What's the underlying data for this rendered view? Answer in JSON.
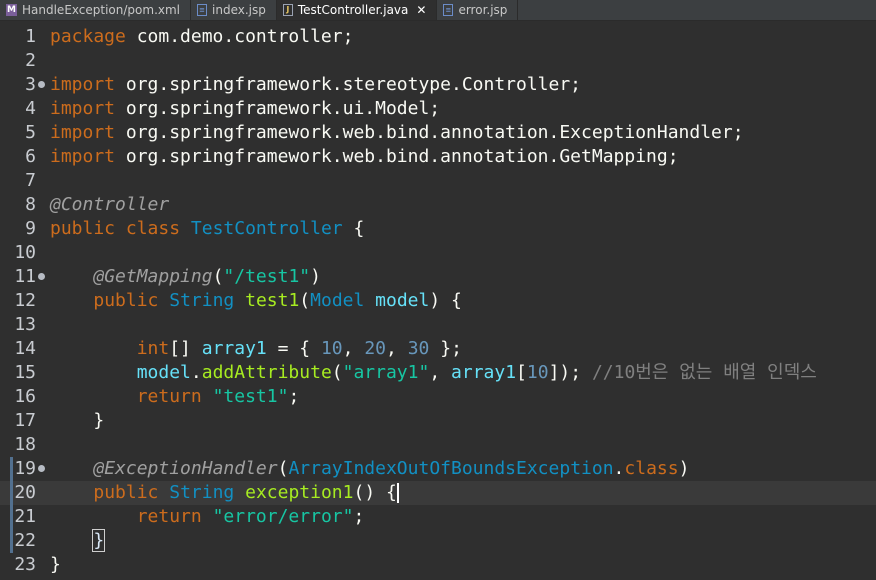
{
  "tabs": [
    {
      "label": "HandleException/pom.xml",
      "icon": "maven-file-icon"
    },
    {
      "label": "index.jsp",
      "icon": "jsp-file-icon"
    },
    {
      "label": "TestController.java",
      "icon": "java-file-icon",
      "active": true,
      "close": "✕"
    },
    {
      "label": "error.jsp",
      "icon": "jsp-file-icon"
    }
  ],
  "editor": {
    "lines": [
      {
        "n": "1",
        "t": [
          [
            "kw",
            "package"
          ],
          [
            "pl",
            " com.demo.controller;"
          ]
        ]
      },
      {
        "n": "2",
        "t": []
      },
      {
        "n": "3",
        "t": [
          [
            "kw",
            "import"
          ],
          [
            "pl",
            " org.springframework.stereotype.Controller;"
          ]
        ]
      },
      {
        "n": "4",
        "t": [
          [
            "kw",
            "import"
          ],
          [
            "pl",
            " org.springframework.ui.Model;"
          ]
        ]
      },
      {
        "n": "5",
        "t": [
          [
            "kw",
            "import"
          ],
          [
            "pl",
            " org.springframework.web.bind.annotation.ExceptionHandler;"
          ]
        ]
      },
      {
        "n": "6",
        "t": [
          [
            "kw",
            "import"
          ],
          [
            "pl",
            " org.springframework.web.bind.annotation.GetMapping;"
          ]
        ]
      },
      {
        "n": "7",
        "t": []
      },
      {
        "n": "8",
        "t": [
          [
            "ann",
            "@Controller"
          ]
        ]
      },
      {
        "n": "9",
        "t": [
          [
            "kw",
            "public"
          ],
          [
            "pl",
            " "
          ],
          [
            "kw",
            "class"
          ],
          [
            "pl",
            " "
          ],
          [
            "cls",
            "TestController"
          ],
          [
            "pl",
            " {"
          ]
        ]
      },
      {
        "n": "10",
        "t": []
      },
      {
        "n": "11",
        "t": [
          [
            "pl",
            "    "
          ],
          [
            "ann",
            "@GetMapping"
          ],
          [
            "pl",
            "("
          ],
          [
            "str",
            "\"/test1\""
          ],
          [
            "pl",
            ")"
          ]
        ]
      },
      {
        "n": "12",
        "t": [
          [
            "pl",
            "    "
          ],
          [
            "kw",
            "public"
          ],
          [
            "pl",
            " "
          ],
          [
            "cls",
            "String"
          ],
          [
            "pl",
            " "
          ],
          [
            "fn",
            "test1"
          ],
          [
            "pl",
            "("
          ],
          [
            "cls",
            "Model"
          ],
          [
            "pl",
            " "
          ],
          [
            "var",
            "model"
          ],
          [
            "pl",
            ") {"
          ]
        ]
      },
      {
        "n": "13",
        "t": []
      },
      {
        "n": "14",
        "t": [
          [
            "pl",
            "        "
          ],
          [
            "kw",
            "int"
          ],
          [
            "pl",
            "[] "
          ],
          [
            "fld",
            "array1"
          ],
          [
            "pl",
            " = { "
          ],
          [
            "num",
            "10"
          ],
          [
            "pl",
            ", "
          ],
          [
            "num",
            "20"
          ],
          [
            "pl",
            ", "
          ],
          [
            "num",
            "30"
          ],
          [
            "pl",
            " };"
          ]
        ]
      },
      {
        "n": "15",
        "t": [
          [
            "pl",
            "        "
          ],
          [
            "var",
            "model"
          ],
          [
            "pl",
            "."
          ],
          [
            "fn",
            "addAttribute"
          ],
          [
            "pl",
            "("
          ],
          [
            "str",
            "\"array1\""
          ],
          [
            "pl",
            ", "
          ],
          [
            "fld",
            "array1"
          ],
          [
            "pl",
            "["
          ],
          [
            "num",
            "10"
          ],
          [
            "pl",
            "]); "
          ],
          [
            "cmt",
            "//10번은 없는 배열 인덱스"
          ]
        ]
      },
      {
        "n": "16",
        "t": [
          [
            "pl",
            "        "
          ],
          [
            "kw",
            "return"
          ],
          [
            "pl",
            " "
          ],
          [
            "str",
            "\"test1\""
          ],
          [
            "pl",
            ";"
          ]
        ]
      },
      {
        "n": "17",
        "t": [
          [
            "pl",
            "    }"
          ]
        ]
      },
      {
        "n": "18",
        "t": []
      },
      {
        "n": "19",
        "t": [
          [
            "pl",
            "    "
          ],
          [
            "ann",
            "@ExceptionHandler"
          ],
          [
            "pl",
            "("
          ],
          [
            "cls",
            "ArrayIndexOutOfBoundsException"
          ],
          [
            "pl",
            "."
          ],
          [
            "kw",
            "class"
          ],
          [
            "pl",
            ")"
          ]
        ]
      },
      {
        "n": "20",
        "t": [
          [
            "pl",
            "    "
          ],
          [
            "kw",
            "public"
          ],
          [
            "pl",
            " "
          ],
          [
            "cls",
            "String"
          ],
          [
            "pl",
            " "
          ],
          [
            "fn",
            "exception1"
          ],
          [
            "pl",
            "() {"
          ]
        ]
      },
      {
        "n": "21",
        "t": [
          [
            "pl",
            "        "
          ],
          [
            "kw",
            "return"
          ],
          [
            "pl",
            " "
          ],
          [
            "str",
            "\"error/error\""
          ],
          [
            "pl",
            ";"
          ]
        ]
      },
      {
        "n": "22",
        "t": [
          [
            "pl",
            "    "
          ],
          [
            "box",
            "}"
          ]
        ]
      },
      {
        "n": "23",
        "t": [
          [
            "pl",
            "}"
          ]
        ]
      }
    ]
  }
}
